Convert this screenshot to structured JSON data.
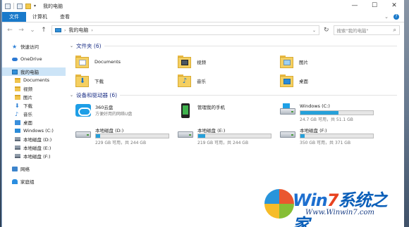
{
  "window": {
    "title": "我的电脑",
    "controls": {
      "minimize": "—",
      "maximize": "☐",
      "close": "✕"
    }
  },
  "ribbon": {
    "file": "文件",
    "tabs": [
      "计算机",
      "查看"
    ],
    "expand": "⌄",
    "help": "?"
  },
  "address": {
    "back": "←",
    "forward": "→",
    "recent": "⌄",
    "up": "↑",
    "path_sep": "›",
    "path": "我的电脑",
    "dropdown": "⌄",
    "refresh": "↻",
    "search_placeholder": "搜索\"我的电脑\"",
    "search_icon": "⌕"
  },
  "sidebar": {
    "quick_access": "快速访问",
    "onedrive": "OneDrive",
    "this_pc": "我的电脑",
    "items": [
      {
        "label": "Documents",
        "icon": "document-folder-icon"
      },
      {
        "label": "视频",
        "icon": "video-folder-icon"
      },
      {
        "label": "图片",
        "icon": "picture-folder-icon"
      },
      {
        "label": "下载",
        "icon": "download-icon"
      },
      {
        "label": "音乐",
        "icon": "music-icon"
      },
      {
        "label": "桌面",
        "icon": "desktop-folder-icon"
      },
      {
        "label": "Windows (C:)",
        "icon": "windows-drive-icon"
      },
      {
        "label": "本地磁盘 (D:)",
        "icon": "drive-icon"
      },
      {
        "label": "本地磁盘 (E:)",
        "icon": "drive-icon"
      },
      {
        "label": "本地磁盘 (F:)",
        "icon": "drive-icon"
      }
    ],
    "network": "网络",
    "homegroup": "家庭组"
  },
  "folders_group": {
    "title": "文件夹 (6)",
    "items": [
      {
        "label": "Documents"
      },
      {
        "label": "视频"
      },
      {
        "label": "图片"
      },
      {
        "label": "下载"
      },
      {
        "label": "音乐"
      },
      {
        "label": "桌面"
      }
    ]
  },
  "drives_group": {
    "title": "设备和驱动器 (6)",
    "items": [
      {
        "name": "360云盘",
        "sub": "方便好用的网络U盘"
      },
      {
        "name": "管理我的手机"
      },
      {
        "name": "Windows (C:)",
        "capacity": "24.7 GB 可用，共 51.1 GB",
        "used_fraction": 0.52
      },
      {
        "name": "本地磁盘 (D:)",
        "capacity": "229 GB 可用，共 244 GB",
        "used_fraction": 0.06
      },
      {
        "name": "本地磁盘 (E:)",
        "capacity": "219 GB 可用，共 244 GB",
        "used_fraction": 0.1
      },
      {
        "name": "本地磁盘 (F:)",
        "capacity": "350 GB 可用，共 371 GB",
        "used_fraction": 0.06
      }
    ]
  },
  "watermark": {
    "brand_win": "Win",
    "brand_seven": "7",
    "brand_cn": "系统之家",
    "url": "Www.Winwin7.com"
  }
}
